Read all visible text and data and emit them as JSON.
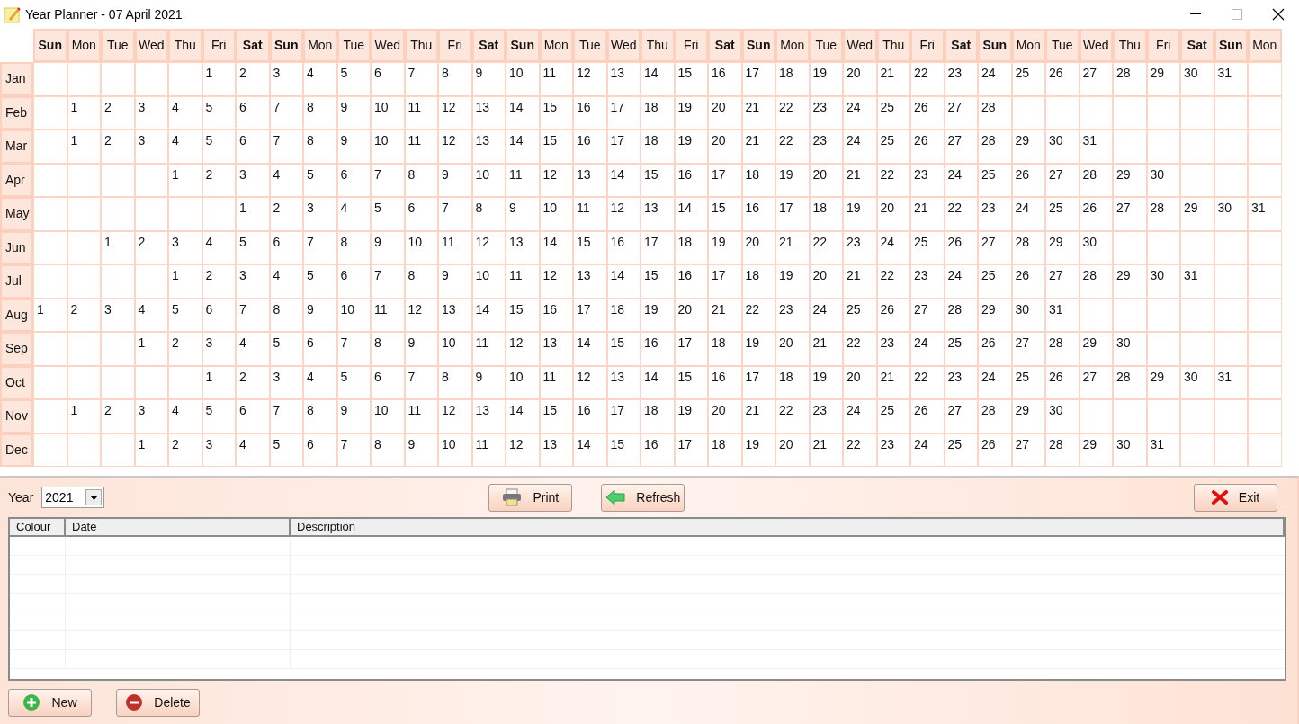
{
  "window": {
    "title": "Year Planner - 07 April 2021"
  },
  "calendar": {
    "weekdays": [
      {
        "label": "Sun",
        "bold": true
      },
      {
        "label": "Mon",
        "bold": false
      },
      {
        "label": "Tue",
        "bold": false
      },
      {
        "label": "Wed",
        "bold": false
      },
      {
        "label": "Thu",
        "bold": false
      },
      {
        "label": "Fri",
        "bold": false
      },
      {
        "label": "Sat",
        "bold": true
      },
      {
        "label": "Sun",
        "bold": true
      },
      {
        "label": "Mon",
        "bold": false
      },
      {
        "label": "Tue",
        "bold": false
      },
      {
        "label": "Wed",
        "bold": false
      },
      {
        "label": "Thu",
        "bold": false
      },
      {
        "label": "Fri",
        "bold": false
      },
      {
        "label": "Sat",
        "bold": true
      },
      {
        "label": "Sun",
        "bold": true
      },
      {
        "label": "Mon",
        "bold": false
      },
      {
        "label": "Tue",
        "bold": false
      },
      {
        "label": "Wed",
        "bold": false
      },
      {
        "label": "Thu",
        "bold": false
      },
      {
        "label": "Fri",
        "bold": false
      },
      {
        "label": "Sat",
        "bold": true
      },
      {
        "label": "Sun",
        "bold": true
      },
      {
        "label": "Mon",
        "bold": false
      },
      {
        "label": "Tue",
        "bold": false
      },
      {
        "label": "Wed",
        "bold": false
      },
      {
        "label": "Thu",
        "bold": false
      },
      {
        "label": "Fri",
        "bold": false
      },
      {
        "label": "Sat",
        "bold": true
      },
      {
        "label": "Sun",
        "bold": true
      },
      {
        "label": "Mon",
        "bold": false
      },
      {
        "label": "Tue",
        "bold": false
      },
      {
        "label": "Wed",
        "bold": false
      },
      {
        "label": "Thu",
        "bold": false
      },
      {
        "label": "Fri",
        "bold": false
      },
      {
        "label": "Sat",
        "bold": true
      },
      {
        "label": "Sun",
        "bold": true
      },
      {
        "label": "Mon",
        "bold": false
      }
    ],
    "months": [
      {
        "label": "Jan",
        "cells": [
          null,
          null,
          null,
          null,
          null,
          "1",
          "2",
          "3",
          "4",
          "5",
          "6",
          "7",
          "8",
          "9",
          "10",
          "11",
          "12",
          "13",
          "14",
          "15",
          "16",
          "17",
          "18",
          "19",
          "20",
          "21",
          "22",
          "23",
          "24",
          "25",
          "26",
          "27",
          "28",
          "29",
          "30",
          "31",
          null
        ]
      },
      {
        "label": "Feb",
        "cells": [
          null,
          "1",
          "2",
          "3",
          "4",
          "5",
          "6",
          "7",
          "8",
          "9",
          "10",
          "11",
          "12",
          "13",
          "14",
          "15",
          "16",
          "17",
          "18",
          "19",
          "20",
          "21",
          "22",
          "23",
          "24",
          "25",
          "26",
          "27",
          "28",
          null,
          null,
          null,
          null,
          null,
          null,
          null,
          null
        ]
      },
      {
        "label": "Mar",
        "cells": [
          null,
          "1",
          "2",
          "3",
          "4",
          "5",
          "6",
          "7",
          "8",
          "9",
          "10",
          "11",
          "12",
          "13",
          "14",
          "15",
          "16",
          "17",
          "18",
          "19",
          "20",
          "21",
          "22",
          "23",
          "24",
          "25",
          "26",
          "27",
          "28",
          "29",
          "30",
          "31",
          null,
          null,
          null,
          null,
          null
        ]
      },
      {
        "label": "Apr",
        "cells": [
          null,
          null,
          null,
          null,
          "1",
          "2",
          "3",
          "4",
          "5",
          "6",
          "7",
          "8",
          "9",
          "10",
          "11",
          "12",
          "13",
          "14",
          "15",
          "16",
          "17",
          "18",
          "19",
          "20",
          "21",
          "22",
          "23",
          "24",
          "25",
          "26",
          "27",
          "28",
          "29",
          "30",
          null,
          null,
          null
        ]
      },
      {
        "label": "May",
        "cells": [
          null,
          null,
          null,
          null,
          null,
          null,
          "1",
          "2",
          "3",
          "4",
          "5",
          "6",
          "7",
          "8",
          "9",
          "10",
          "11",
          "12",
          "13",
          "14",
          "15",
          "16",
          "17",
          "18",
          "19",
          "20",
          "21",
          "22",
          "23",
          "24",
          "25",
          "26",
          "27",
          "28",
          "29",
          "30",
          "31"
        ]
      },
      {
        "label": "Jun",
        "cells": [
          null,
          null,
          "1",
          "2",
          "3",
          "4",
          "5",
          "6",
          "7",
          "8",
          "9",
          "10",
          "11",
          "12",
          "13",
          "14",
          "15",
          "16",
          "17",
          "18",
          "19",
          "20",
          "21",
          "22",
          "23",
          "24",
          "25",
          "26",
          "27",
          "28",
          "29",
          "30",
          null,
          null,
          null,
          null,
          null
        ]
      },
      {
        "label": "Jul",
        "cells": [
          null,
          null,
          null,
          null,
          "1",
          "2",
          "3",
          "4",
          "5",
          "6",
          "7",
          "8",
          "9",
          "10",
          "11",
          "12",
          "13",
          "14",
          "15",
          "16",
          "17",
          "18",
          "19",
          "20",
          "21",
          "22",
          "23",
          "24",
          "25",
          "26",
          "27",
          "28",
          "29",
          "30",
          "31",
          null,
          null
        ]
      },
      {
        "label": "Aug",
        "cells": [
          "1",
          "2",
          "3",
          "4",
          "5",
          "6",
          "7",
          "8",
          "9",
          "10",
          "11",
          "12",
          "13",
          "14",
          "15",
          "16",
          "17",
          "18",
          "19",
          "20",
          "21",
          "22",
          "23",
          "24",
          "25",
          "26",
          "27",
          "28",
          "29",
          "30",
          "31",
          null,
          null,
          null,
          null,
          null,
          null
        ]
      },
      {
        "label": "Sep",
        "cells": [
          null,
          null,
          null,
          "1",
          "2",
          "3",
          "4",
          "5",
          "6",
          "7",
          "8",
          "9",
          "10",
          "11",
          "12",
          "13",
          "14",
          "15",
          "16",
          "17",
          "18",
          "19",
          "20",
          "21",
          "22",
          "23",
          "24",
          "25",
          "26",
          "27",
          "28",
          "29",
          "30",
          null,
          null,
          null,
          null
        ]
      },
      {
        "label": "Oct",
        "cells": [
          null,
          null,
          null,
          null,
          null,
          "1",
          "2",
          "3",
          "4",
          "5",
          "6",
          "7",
          "8",
          "9",
          "10",
          "11",
          "12",
          "13",
          "14",
          "15",
          "16",
          "17",
          "18",
          "19",
          "20",
          "21",
          "22",
          "23",
          "24",
          "25",
          "26",
          "27",
          "28",
          "29",
          "30",
          "31",
          null
        ]
      },
      {
        "label": "Nov",
        "cells": [
          null,
          "1",
          "2",
          "3",
          "4",
          "5",
          "6",
          "7",
          "8",
          "9",
          "10",
          "11",
          "12",
          "13",
          "14",
          "15",
          "16",
          "17",
          "18",
          "19",
          "20",
          "21",
          "22",
          "23",
          "24",
          "25",
          "26",
          "27",
          "28",
          "29",
          "30",
          null,
          null,
          null,
          null,
          null,
          null
        ]
      },
      {
        "label": "Dec",
        "cells": [
          null,
          null,
          null,
          "1",
          "2",
          "3",
          "4",
          "5",
          "6",
          "7",
          "8",
          "9",
          "10",
          "11",
          "12",
          "13",
          "14",
          "15",
          "16",
          "17",
          "18",
          "19",
          "20",
          "21",
          "22",
          "23",
          "24",
          "25",
          "26",
          "27",
          "28",
          "29",
          "30",
          "31",
          null,
          null,
          null
        ]
      }
    ]
  },
  "toolbar": {
    "year_label": "Year",
    "year_value": "2021",
    "print": "Print",
    "refresh": "Refresh",
    "exit": "Exit"
  },
  "events_table": {
    "columns": [
      "Colour",
      "Date",
      "Description"
    ]
  },
  "footer": {
    "new": "New",
    "delete": "Delete"
  }
}
